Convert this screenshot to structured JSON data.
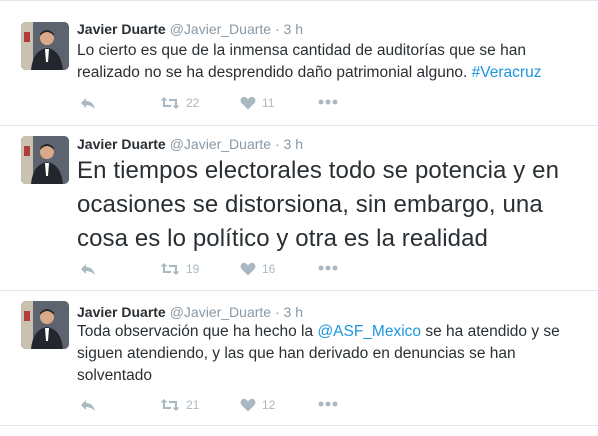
{
  "tweets": [
    {
      "name": "Javier Duarte",
      "handle": "@Javier_Duarte",
      "dot": "·",
      "time": "3 h",
      "text_before": "Lo cierto es que de la inmensa cantidad de auditorías que se han realizado no se ha desprendido daño patrimonial alguno. ",
      "link": "#Veracruz",
      "text_after": "",
      "retweets": "22",
      "likes": "11"
    },
    {
      "name": "Javier Duarte",
      "handle": "@Javier_Duarte",
      "dot": "·",
      "time": "3 h",
      "text_before": "En tiempos electorales todo se potencia y en ocasiones se distorsiona, sin embargo, una cosa es lo político y otra es la realidad",
      "link": "",
      "text_after": "",
      "retweets": "19",
      "likes": "16"
    },
    {
      "name": "Javier Duarte",
      "handle": "@Javier_Duarte",
      "dot": "·",
      "time": "3 h",
      "text_before": "Toda observación que ha hecho la ",
      "link": "@ASF_Mexico",
      "text_after": " se ha atendido y se siguen atendiendo, y las que han derivado en denuncias se han solventado",
      "retweets": "21",
      "likes": "12"
    }
  ],
  "colors": {
    "link": "#1b95e0",
    "meta": "#8899a6",
    "action": "#aab8c2",
    "divider": "#e1e8ed"
  },
  "icons": [
    "reply-icon",
    "retweet-icon",
    "heart-icon",
    "more-icon"
  ]
}
